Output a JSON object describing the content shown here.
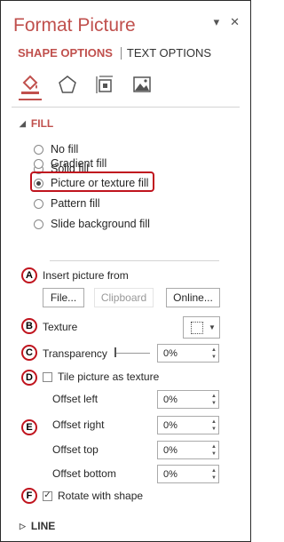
{
  "pane": {
    "title": "Format Picture",
    "pin_icon": "▾",
    "close_icon": "✕"
  },
  "tabs": {
    "shape_options": "SHAPE OPTIONS",
    "text_options": "TEXT OPTIONS"
  },
  "icons": [
    "fill-line-icon",
    "effects-icon",
    "size-properties-icon",
    "picture-icon"
  ],
  "fill": {
    "header": "FILL",
    "options": [
      "No fill",
      "Solid fill",
      "Gradient fill",
      "Picture or texture fill",
      "Pattern fill",
      "Slide background fill"
    ],
    "selected": "Picture or texture fill",
    "insert_picture_from": "Insert picture from",
    "file_button": "File...",
    "clipboard_button": "Clipboard",
    "online_button": "Online...",
    "texture_label": "Texture",
    "transparency_label": "Transparency",
    "transparency_value": "0%",
    "tile_label": "Tile picture as texture",
    "offset_left_label": "Offset left",
    "offset_left_value": "0%",
    "offset_right_label": "Offset right",
    "offset_right_value": "0%",
    "offset_top_label": "Offset top",
    "offset_top_value": "0%",
    "offset_bottom_label": "Offset bottom",
    "offset_bottom_value": "0%",
    "rotate_label": "Rotate with shape",
    "rotate_checked": true
  },
  "line": {
    "header": "LINE"
  },
  "callouts": [
    "A",
    "B",
    "C",
    "D",
    "E",
    "F"
  ],
  "colors": {
    "accent": "#c0504d",
    "highlight": "#c0141e"
  }
}
